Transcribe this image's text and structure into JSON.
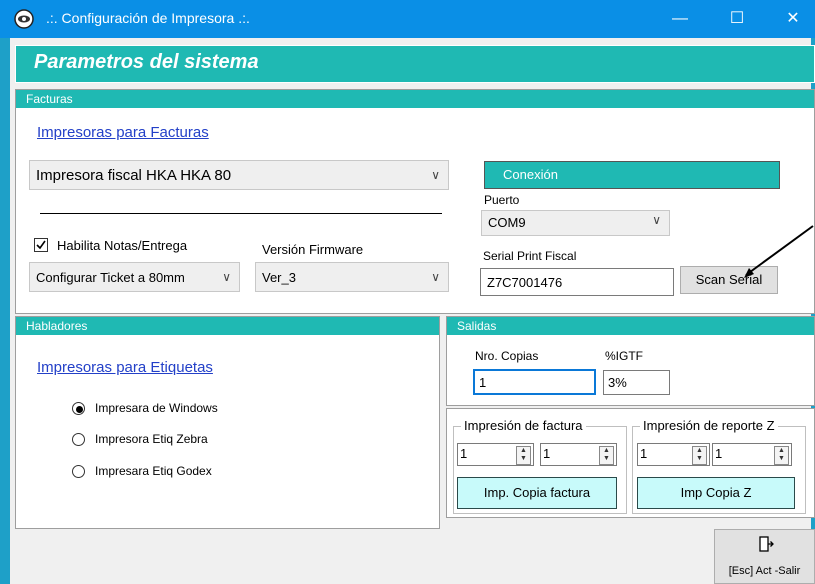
{
  "window": {
    "title": ".:. Configuración de Impresora .:.",
    "minimize": "—",
    "maximize": "☐",
    "close": "✕"
  },
  "header": {
    "title": "Parametros del sistema"
  },
  "facturas": {
    "label": "Facturas",
    "printers_link": "Impresoras para Facturas",
    "printer_selected": "Impresora fiscal HKA HKA 80",
    "habilita_checked": true,
    "habilita_label": "Habilita Notas/Entrega",
    "firmware_label": "Versión Firmware",
    "ticket_selected": "Configurar Ticket a 80mm",
    "firmware_selected": "Ver_3",
    "conexion": "Conexión",
    "puerto_label": "Puerto",
    "puerto_selected": "COM9",
    "serial_label": "Serial Print Fiscal",
    "serial_value": "Z7C7001476",
    "scan_button": "Scan Serial"
  },
  "habladores": {
    "label": "Habladores",
    "labels_link": "Impresoras para Etiquetas",
    "options": [
      {
        "label": "Impresara de Windows",
        "selected": true
      },
      {
        "label": "Impresora Etiq Zebra",
        "selected": false
      },
      {
        "label": "Impresara Etiq Godex",
        "selected": false
      }
    ]
  },
  "salidas": {
    "label": "Salidas",
    "copias_label": "Nro. Copias",
    "copias_value": "1",
    "igtf_label": "%IGTF",
    "igtf_value": "3%",
    "factura_group": "Impresión de factura",
    "factura_spin1": "1",
    "factura_spin2": "1",
    "factura_button": "Imp. Copia factura",
    "reportez_group": "Impresión de reporte Z",
    "reportez_spin1": "1",
    "reportez_spin2": "1",
    "reportez_button": "Imp Copia Z"
  },
  "exit_button": "[Esc] Act -Salir",
  "colors": {
    "titlebar": "#0a8fe6",
    "accent": "#1fb9b3",
    "copy_button": "#c8fafa",
    "link": "#2340c8"
  }
}
